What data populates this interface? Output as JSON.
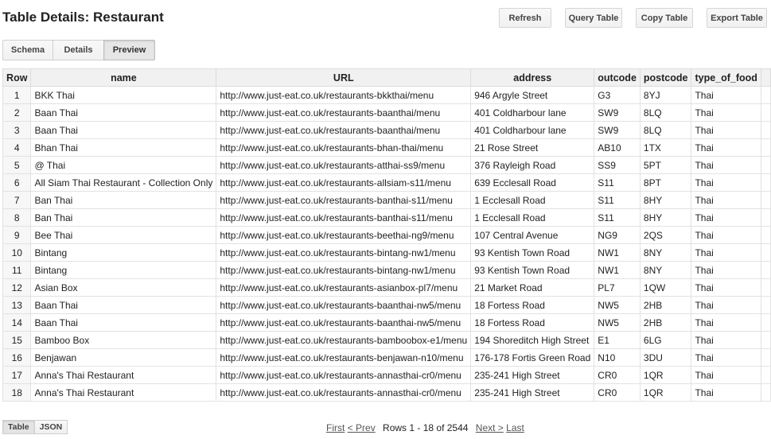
{
  "header": {
    "title": "Table Details: Restaurant",
    "buttons": {
      "refresh": "Refresh",
      "query": "Query Table",
      "copy": "Copy Table",
      "export": "Export Table"
    }
  },
  "tabs": [
    {
      "label": "Schema",
      "active": false
    },
    {
      "label": "Details",
      "active": false
    },
    {
      "label": "Preview",
      "active": true
    }
  ],
  "table": {
    "columns": [
      "Row",
      "name",
      "URL",
      "address",
      "outcode",
      "postcode",
      "type_of_food"
    ],
    "rows": [
      [
        "1",
        "BKK Thai",
        "http://www.just-eat.co.uk/restaurants-bkkthai/menu",
        "946 Argyle Street",
        "G3",
        "8YJ",
        "Thai"
      ],
      [
        "2",
        "Baan Thai",
        "http://www.just-eat.co.uk/restaurants-baanthai/menu",
        "401 Coldharbour lane",
        "SW9",
        "8LQ",
        "Thai"
      ],
      [
        "3",
        "Baan Thai",
        "http://www.just-eat.co.uk/restaurants-baanthai/menu",
        "401 Coldharbour lane",
        "SW9",
        "8LQ",
        "Thai"
      ],
      [
        "4",
        "Bhan Thai",
        "http://www.just-eat.co.uk/restaurants-bhan-thai/menu",
        "21 Rose Street",
        "AB10",
        "1TX",
        "Thai"
      ],
      [
        "5",
        "@ Thai",
        "http://www.just-eat.co.uk/restaurants-atthai-ss9/menu",
        "376 Rayleigh Road",
        "SS9",
        "5PT",
        "Thai"
      ],
      [
        "6",
        "All Siam Thai Restaurant - Collection Only",
        "http://www.just-eat.co.uk/restaurants-allsiam-s11/menu",
        "639 Ecclesall Road",
        "S11",
        "8PT",
        "Thai"
      ],
      [
        "7",
        "Ban Thai",
        "http://www.just-eat.co.uk/restaurants-banthai-s11/menu",
        "1 Ecclesall Road",
        "S11",
        "8HY",
        "Thai"
      ],
      [
        "8",
        "Ban Thai",
        "http://www.just-eat.co.uk/restaurants-banthai-s11/menu",
        "1 Ecclesall Road",
        "S11",
        "8HY",
        "Thai"
      ],
      [
        "9",
        "Bee Thai",
        "http://www.just-eat.co.uk/restaurants-beethai-ng9/menu",
        "107 Central Avenue",
        "NG9",
        "2QS",
        "Thai"
      ],
      [
        "10",
        "Bintang",
        "http://www.just-eat.co.uk/restaurants-bintang-nw1/menu",
        "93 Kentish Town Road",
        "NW1",
        "8NY",
        "Thai"
      ],
      [
        "11",
        "Bintang",
        "http://www.just-eat.co.uk/restaurants-bintang-nw1/menu",
        "93 Kentish Town Road",
        "NW1",
        "8NY",
        "Thai"
      ],
      [
        "12",
        "Asian Box",
        "http://www.just-eat.co.uk/restaurants-asianbox-pl7/menu",
        "21 Market Road",
        "PL7",
        "1QW",
        "Thai"
      ],
      [
        "13",
        "Baan Thai",
        "http://www.just-eat.co.uk/restaurants-baanthai-nw5/menu",
        "18 Fortess Road",
        "NW5",
        "2HB",
        "Thai"
      ],
      [
        "14",
        "Baan Thai",
        "http://www.just-eat.co.uk/restaurants-baanthai-nw5/menu",
        "18 Fortess Road",
        "NW5",
        "2HB",
        "Thai"
      ],
      [
        "15",
        "Bamboo Box",
        "http://www.just-eat.co.uk/restaurants-bamboobox-e1/menu",
        "194 Shoreditch High Street",
        "E1",
        "6LG",
        "Thai"
      ],
      [
        "16",
        "Benjawan",
        "http://www.just-eat.co.uk/restaurants-benjawan-n10/menu",
        "176-178 Fortis Green Road",
        "N10",
        "3DU",
        "Thai"
      ],
      [
        "17",
        "Anna's Thai Restaurant",
        "http://www.just-eat.co.uk/restaurants-annasthai-cr0/menu",
        "235-241 High Street",
        "CR0",
        "1QR",
        "Thai"
      ],
      [
        "18",
        "Anna's Thai Restaurant",
        "http://www.just-eat.co.uk/restaurants-annasthai-cr0/menu",
        "235-241 High Street",
        "CR0",
        "1QR",
        "Thai"
      ]
    ]
  },
  "view_toggle": [
    {
      "label": "Table",
      "active": true
    },
    {
      "label": "JSON",
      "active": false
    }
  ],
  "pager": {
    "first": "First",
    "prev": "< Prev",
    "status": "Rows 1 - 18 of 2544",
    "next": "Next >",
    "last": "Last"
  }
}
